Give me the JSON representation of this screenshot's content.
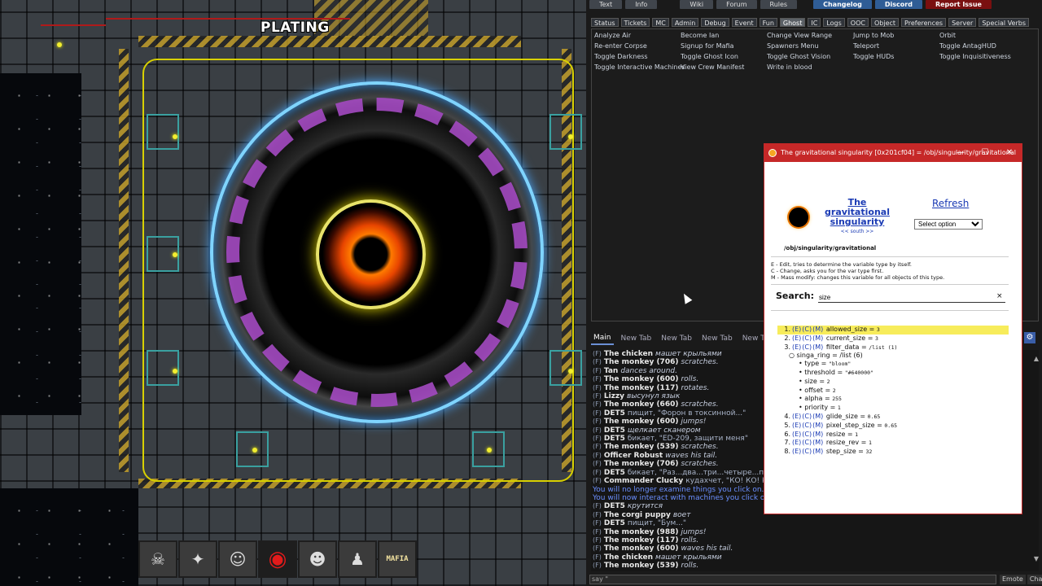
{
  "game": {
    "turf_label": "PLATING",
    "hotbar": [
      {
        "icon": "intent-icon",
        "glyph": "☠"
      },
      {
        "icon": "flashlight-icon",
        "glyph": "✦"
      },
      {
        "icon": "ghost-figure-icon",
        "glyph": "☺"
      },
      {
        "icon": "singularity-icon",
        "glyph": "◉"
      },
      {
        "icon": "crew-figure-icon",
        "glyph": "☻"
      },
      {
        "icon": "spacesuit-icon",
        "glyph": "♟"
      },
      {
        "icon": "mafia-hat-icon",
        "glyph": "MAFIA"
      }
    ]
  },
  "top_links": [
    {
      "label": "Text",
      "style": ""
    },
    {
      "label": "Info",
      "style": ""
    },
    {
      "label": "Wiki",
      "style": ""
    },
    {
      "label": "Forum",
      "style": ""
    },
    {
      "label": "Rules",
      "style": ""
    },
    {
      "label": "Changelog",
      "style": "accent"
    },
    {
      "label": "Discord",
      "style": "accent"
    },
    {
      "label": "Report Issue",
      "style": "danger"
    }
  ],
  "stat_tabs": [
    "Status",
    "Tickets",
    "MC",
    "Admin",
    "Debug",
    "Event",
    "Fun",
    "Ghost",
    "IC",
    "Logs",
    "OOC",
    "Object",
    "Preferences",
    "Server",
    "Special Verbs"
  ],
  "active_stat_tab": "Ghost",
  "verbs": [
    "Analyze Air",
    "Become Ian",
    "Change View Range",
    "Jump to Mob",
    "Orbit",
    "Re-enter Corpse",
    "Signup for Mafia",
    "Spawners Menu",
    "Teleport",
    "Toggle AntagHUD",
    "Toggle Darkness",
    "Toggle Ghost Icon",
    "Toggle Ghost Vision",
    "Toggle HUDs",
    "Toggle Inquisitiveness",
    "Toggle Interactive Machines",
    "View Crew Manifest",
    "Write in blood"
  ],
  "chat_tabs": [
    "Main",
    "New Tab",
    "New Tab",
    "New Tab",
    "New Tab"
  ],
  "chat_gear_glyph": "⚙",
  "chat": [
    {
      "tag": "(F)",
      "who": "The chicken",
      "text": "машет крыльями",
      "italic": true
    },
    {
      "tag": "(F)",
      "who": "The monkey (706)",
      "text": "scratches.",
      "italic": true
    },
    {
      "tag": "(F)",
      "who": "Tan",
      "text": "dances around.",
      "italic": true
    },
    {
      "tag": "(F)",
      "who": "The monkey (600)",
      "text": "rolls.",
      "italic": true
    },
    {
      "tag": "(F)",
      "who": "The monkey (117)",
      "text": "rotates.",
      "italic": true
    },
    {
      "tag": "(F)",
      "who": "Lizzy",
      "text": "высунул язык",
      "italic": true
    },
    {
      "tag": "(F)",
      "who": "The monkey (660)",
      "text": "scratches.",
      "italic": true
    },
    {
      "tag": "(F)",
      "who": "DET5",
      "text": "пищит, \"Форон в токсинной...\"",
      "italic": false
    },
    {
      "tag": "(F)",
      "who": "The monkey (600)",
      "text": "jumps!",
      "italic": true
    },
    {
      "tag": "(F)",
      "who": "DET5",
      "text": "щелкает сканером",
      "italic": true
    },
    {
      "tag": "(F)",
      "who": "DET5",
      "text": "бикает, \"ED-209, защити меня\"",
      "italic": false
    },
    {
      "tag": "(F)",
      "who": "The monkey (539)",
      "text": "scratches.",
      "italic": true
    },
    {
      "tag": "(F)",
      "who": "Officer Robust",
      "text": "waves his tail.",
      "italic": true
    },
    {
      "tag": "(F)",
      "who": "The monkey (706)",
      "text": "scratches.",
      "italic": true
    },
    {
      "tag": "(F)",
      "who": "DET5",
      "text": "бикает, \"Раз...два...три...четыре...пя",
      "italic": false
    },
    {
      "tag": "(F)",
      "who": "Commander Clucky",
      "text": "кудахчет, \"КО! КО! КО!\"",
      "italic": false
    },
    {
      "tag": "",
      "who": "",
      "text": "You will no longer examine things you click on.",
      "italic": false,
      "notice": true
    },
    {
      "tag": "",
      "who": "",
      "text": "You will now interact with machines you click on.",
      "italic": false,
      "notice": true
    },
    {
      "tag": "(F)",
      "who": "DET5",
      "text": "крутится",
      "italic": true
    },
    {
      "tag": "(F)",
      "who": "The corgi puppy",
      "text": "воет",
      "italic": true
    },
    {
      "tag": "(F)",
      "who": "DET5",
      "text": "пищит, \"Бум...\"",
      "italic": false
    },
    {
      "tag": "(F)",
      "who": "The monkey (988)",
      "text": "jumps!",
      "italic": true
    },
    {
      "tag": "(F)",
      "who": "The monkey (117)",
      "text": "rolls.",
      "italic": true
    },
    {
      "tag": "(F)",
      "who": "The monkey (600)",
      "text": "waves his tail.",
      "italic": true
    },
    {
      "tag": "(F)",
      "who": "The chicken",
      "text": "машет крыльями",
      "italic": true
    },
    {
      "tag": "(F)",
      "who": "The monkey (539)",
      "text": "rolls.",
      "italic": true
    }
  ],
  "input": {
    "value": "say \"",
    "buttons": [
      "Emote",
      "Chat"
    ]
  },
  "scroll": {
    "up": "▲",
    "down": "▼"
  },
  "vv": {
    "window_title": "The gravitational singularity [0x201cf04] = /obj/singularity/gravitational",
    "controls": [
      "—",
      "☐",
      "✕"
    ],
    "name": "The gravitational singularity",
    "nav": "<< south >>",
    "refresh": "Refresh",
    "select_option": "Select option",
    "path": "/obj/singularity/gravitational",
    "help": [
      "E - Edit, tries to determine the variable type by itself.",
      "C - Change, asks you for the var type first.",
      "M - Mass modify: changes this variable for all objects of this type."
    ],
    "search_label": "Search:",
    "search_value": "size",
    "search_clear": "×",
    "vars": [
      {
        "num": "1.",
        "name": "allowed_size",
        "value": "3",
        "highlight": true
      },
      {
        "num": "2.",
        "name": "current_size",
        "value": "3"
      },
      {
        "num": "3.",
        "name": "filter_data",
        "value": "/list (1)",
        "children": [
          {
            "indent": 1,
            "text": "○ singa_ring = /list (6)",
            "value": ""
          },
          {
            "indent": 2,
            "text": "• type = ",
            "value": "\"bloom\""
          },
          {
            "indent": 2,
            "text": "• threshold = ",
            "value": "\"#640000\""
          },
          {
            "indent": 2,
            "text": "• size = ",
            "value": "2"
          },
          {
            "indent": 2,
            "text": "• offset = ",
            "value": "2"
          },
          {
            "indent": 2,
            "text": "• alpha = ",
            "value": "255"
          },
          {
            "indent": 2,
            "text": "• priority = ",
            "value": "1"
          }
        ]
      },
      {
        "num": "4.",
        "name": "glide_size",
        "value": "0.65"
      },
      {
        "num": "5.",
        "name": "pixel_step_size",
        "value": "0.65"
      },
      {
        "num": "6.",
        "name": "resize",
        "value": "1"
      },
      {
        "num": "7.",
        "name": "resize_rev",
        "value": "1"
      },
      {
        "num": "8.",
        "name": "step_size",
        "value": "32"
      }
    ],
    "var_actions": [
      "(E)",
      "(C)",
      "(M)"
    ]
  }
}
